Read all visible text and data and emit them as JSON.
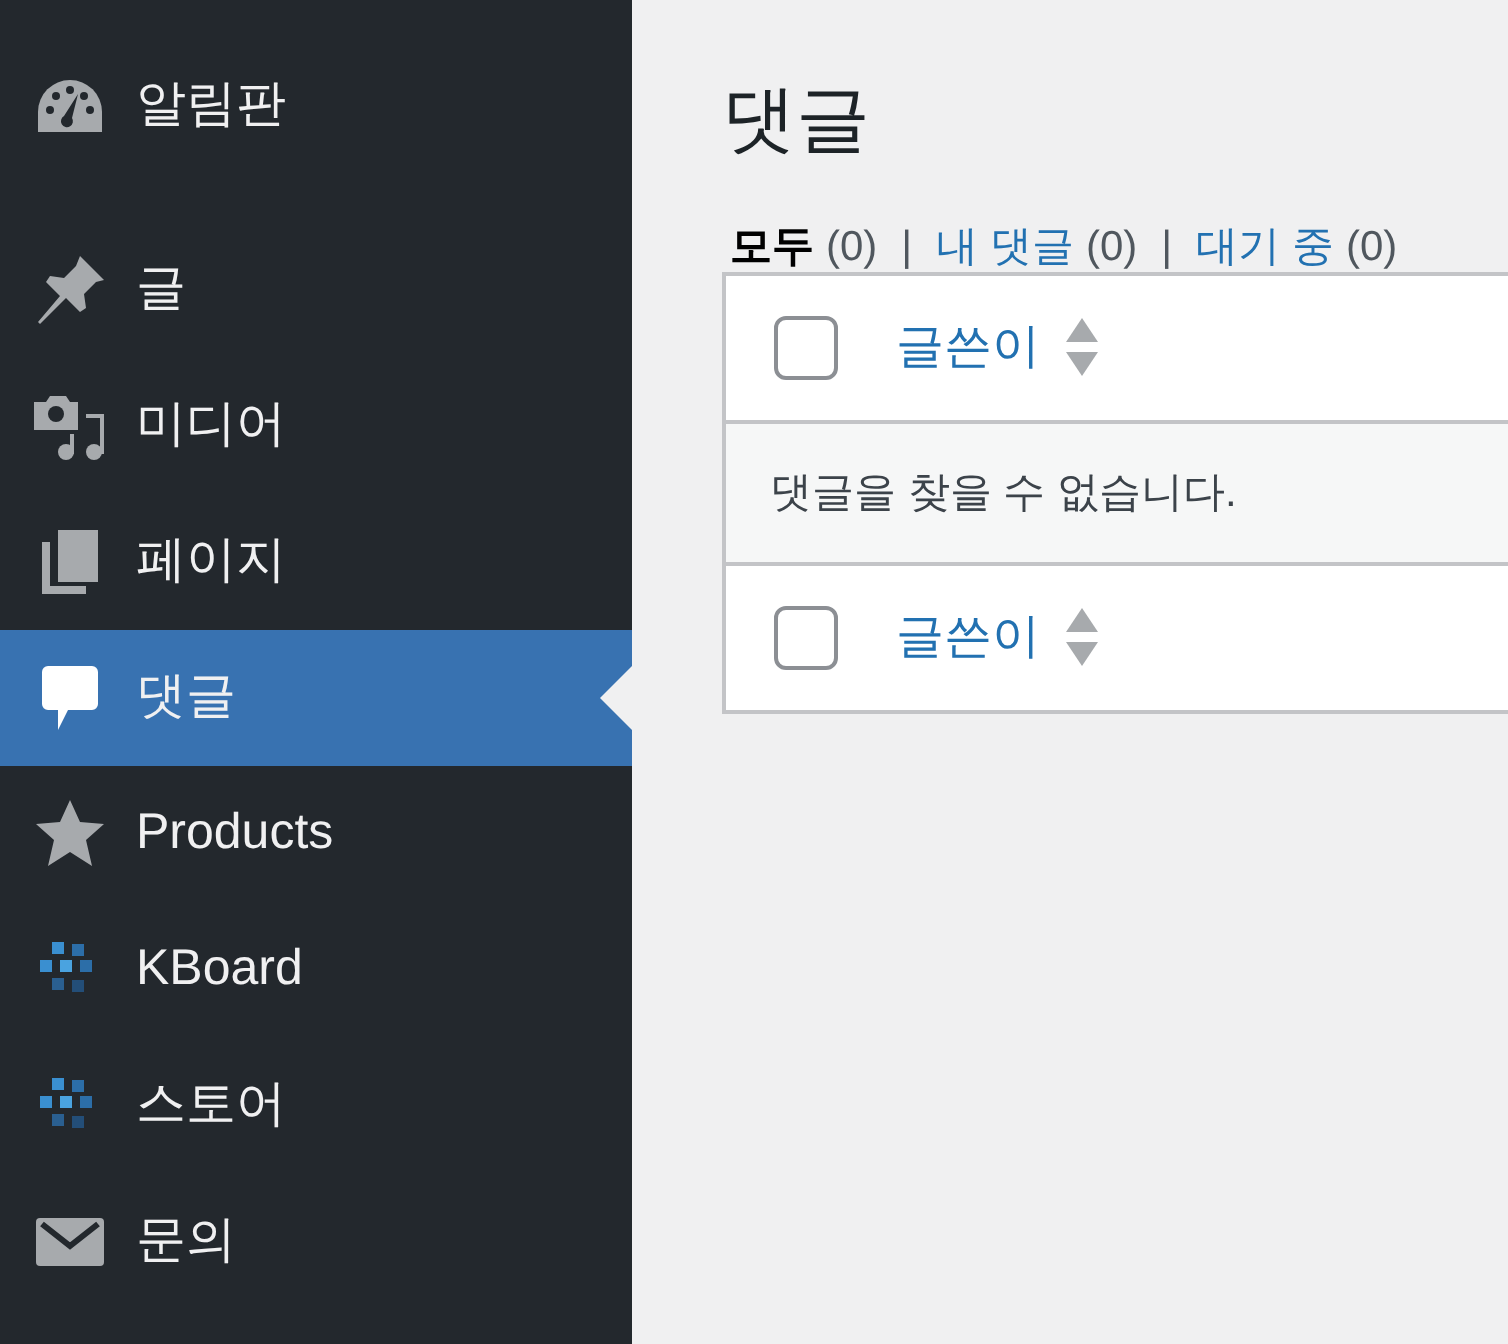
{
  "sidebar": {
    "items": [
      {
        "label": "알림판",
        "selected": false
      },
      {
        "label": "글",
        "selected": false
      },
      {
        "label": "미디어",
        "selected": false
      },
      {
        "label": "페이지",
        "selected": false
      },
      {
        "label": "댓글",
        "selected": true
      },
      {
        "label": "Products",
        "selected": false
      },
      {
        "label": "KBoard",
        "selected": false
      },
      {
        "label": "스토어",
        "selected": false
      },
      {
        "label": "문의",
        "selected": false
      }
    ]
  },
  "page": {
    "title": "댓글",
    "filters": [
      {
        "label": "모두",
        "count": "(0)",
        "selected": true,
        "separator": "|"
      },
      {
        "label": "내 댓글",
        "count": "(0)",
        "selected": false,
        "separator": "|"
      },
      {
        "label": "대기 중",
        "count": "(0)",
        "selected": false
      }
    ],
    "table": {
      "header": {
        "checked": false,
        "column": "글쓴이"
      },
      "empty_message": "댓글을 찾을 수 없습니다.",
      "footer": {
        "checked": false,
        "column": "글쓴이"
      }
    }
  }
}
